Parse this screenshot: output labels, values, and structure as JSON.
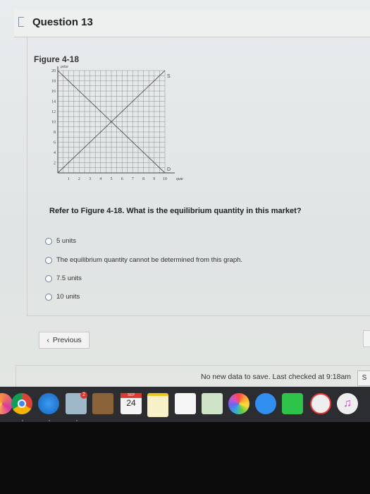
{
  "question": {
    "title": "Question 13",
    "figure_title": "Figure 4-18",
    "text": "Refer to Figure 4-18. What is the equilibrium quantity in this market?",
    "options": [
      "5 units",
      "The equilibrium quantity cannot be determined from this graph.",
      "7.5 units",
      "10 units"
    ]
  },
  "nav": {
    "previous_label": "Previous",
    "previous_icon": "chevron-left-icon",
    "next_label": "S"
  },
  "status": "No new data to save. Last checked at 9:18am",
  "dock": {
    "mail_badge": "2",
    "calendar_month": "SEP",
    "calendar_day": "24",
    "apps": [
      "chrome",
      "safari",
      "mail",
      "contacts",
      "calendar",
      "notes",
      "reminders",
      "maps",
      "photos",
      "messages",
      "facetime",
      "news",
      "music"
    ]
  },
  "chart_data": {
    "type": "line",
    "xlabel": "quantity",
    "ylabel": "price",
    "xlim": [
      0,
      10
    ],
    "ylim": [
      0,
      20
    ],
    "x_ticks": [
      1,
      2,
      3,
      4,
      5,
      6,
      7,
      8,
      9,
      10
    ],
    "y_ticks": [
      2,
      4,
      6,
      8,
      10,
      12,
      14,
      16,
      18,
      20
    ],
    "grid": true,
    "series": [
      {
        "name": "S",
        "x": [
          0,
          10
        ],
        "y": [
          0,
          20
        ]
      },
      {
        "name": "D",
        "x": [
          0,
          10
        ],
        "y": [
          20,
          0
        ]
      }
    ]
  }
}
